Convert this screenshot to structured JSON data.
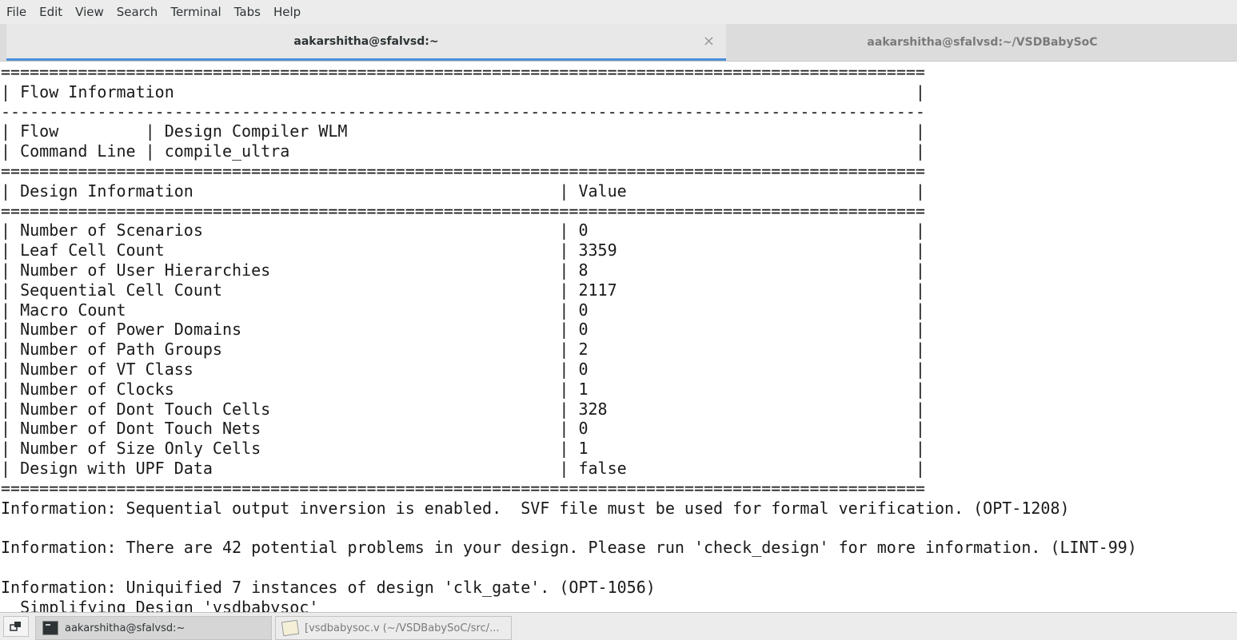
{
  "menubar": {
    "items": [
      "File",
      "Edit",
      "View",
      "Search",
      "Terminal",
      "Tabs",
      "Help"
    ]
  },
  "tabs": [
    {
      "label": "aakarshitha@sfalvsd:~",
      "active": true,
      "close": "×"
    },
    {
      "label": "aakarshitha@sfalvsd:~/VSDBabySoC",
      "active": false
    }
  ],
  "terminal": {
    "lines": [
      "================================================================================================",
      "| Flow Information                                                                             |",
      "------------------------------------------------------------------------------------------------",
      "| Flow         | Design Compiler WLM                                                           |",
      "| Command Line | compile_ultra                                                                 |",
      "================================================================================================",
      "| Design Information                                      | Value                              |",
      "================================================================================================",
      "| Number of Scenarios                                     | 0                                  |",
      "| Leaf Cell Count                                         | 3359                               |",
      "| Number of User Hierarchies                              | 8                                  |",
      "| Sequential Cell Count                                   | 2117                               |",
      "| Macro Count                                             | 0                                  |",
      "| Number of Power Domains                                 | 0                                  |",
      "| Number of Path Groups                                   | 2                                  |",
      "| Number of VT Class                                      | 0                                  |",
      "| Number of Clocks                                        | 1                                  |",
      "| Number of Dont Touch Cells                              | 328                                |",
      "| Number of Dont Touch Nets                               | 0                                  |",
      "| Number of Size Only Cells                               | 1                                  |",
      "| Design with UPF Data                                    | false                              |",
      "================================================================================================",
      "Information: Sequential output inversion is enabled.  SVF file must be used for formal verification. (OPT-1208)",
      "",
      "Information: There are 42 potential problems in your design. Please run 'check_design' for more information. (LINT-99)",
      "",
      "Information: Uniquified 7 instances of design 'clk_gate'. (OPT-1056)",
      "  Simplifying Design 'vsdbabysoc'"
    ]
  },
  "taskbar": {
    "tasks": [
      {
        "label": "aakarshitha@sfalvsd:~",
        "icon": "terminal-icon",
        "active": true
      },
      {
        "label": "[vsdbabysoc.v (~/VSDBabySoC/src/...",
        "icon": "text-editor-icon",
        "active": false
      }
    ]
  }
}
